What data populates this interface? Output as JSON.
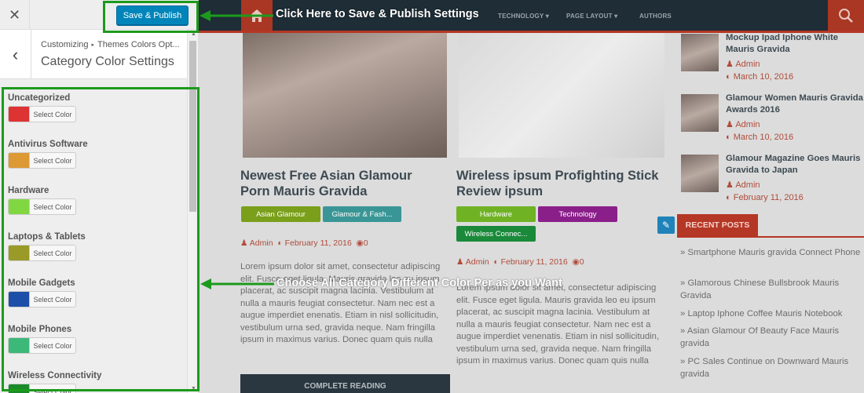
{
  "customizer": {
    "close_symbol": "✕",
    "save_label": "Save & Publish",
    "back_symbol": "‹",
    "breadcrumb_root": "Customizing",
    "breadcrumb_separator": "▸",
    "breadcrumb_parent": "Themes Colors Opt...",
    "section_title": "Category Color Settings",
    "scroll_up": "▲",
    "scroll_down": "▼",
    "picker_label": "Select Color",
    "categories": [
      {
        "label": "Uncategorized",
        "color": "#dd3333"
      },
      {
        "label": "Antivirus Software",
        "color": "#dd9933"
      },
      {
        "label": "Hardware",
        "color": "#81d742"
      },
      {
        "label": "Laptops & Tablets",
        "color": "#999a28"
      },
      {
        "label": "Mobile Gadgets",
        "color": "#1e4fa8"
      },
      {
        "label": "Mobile Phones",
        "color": "#3cb878"
      },
      {
        "label": "Wireless Connectivity",
        "color": "#1a8a2a"
      }
    ]
  },
  "preview": {
    "nav": {
      "technology": "TECHNOLOGY",
      "page_layout": "PAGE LAYOUT",
      "authors": "AUTHORS",
      "chevron": "▾"
    },
    "posts": [
      {
        "title": "Newest Free Asian Glamour Porn Mauris Gravida",
        "tags": [
          {
            "label": "Asian Glamour",
            "color": "#7a9f1a"
          },
          {
            "label": "Glamour & Fash...",
            "color": "#3a9696"
          }
        ],
        "author": "Admin",
        "date": "February 11, 2016",
        "comments": "0",
        "excerpt": "Lorem ipsum dolor sit amet, consectetur adipiscing elit. Fusce eget ligula. Mauris gravida leo eu ipsum placerat, ac suscipit magna lacinia. Vestibulum at nulla a mauris feugiat consectetur. Nam nec est a augue imperdiet enenatis. Etiam in nisl sollicitudin, vestibulum urna sed, gravida neque. Nam fringilla ipsum in maximus varius. Donec  quam quis nulla",
        "read_more": "COMPLETE READING"
      },
      {
        "title": "Wireless ipsum Profighting Stick Review ipsum",
        "tags": [
          {
            "label": "Hardware",
            "color": "#6fb325"
          },
          {
            "label": "Technology",
            "color": "#8a1f8a"
          },
          {
            "label": "Wireless Connec...",
            "color": "#1a8a3a"
          }
        ],
        "author": "Admin",
        "date": "February 11, 2016",
        "comments": "0",
        "excerpt": "Lorem ipsum dolor sit amet, consectetur adipiscing elit. Fusce eget ligula. Mauris gravida leo eu ipsum placerat, ac suscipit magna lacinia. Vestibulum at nulla a mauris feugiat consectetur. Nam nec est a augue imperdiet venenatis. Etiam in nisl sollicitudin, vestibulum urna sed, gravida neque. Nam fringilla ipsum in maximus varius. Donec quam quis nulla"
      }
    ],
    "sidebar_posts": [
      {
        "title": "Mockup Ipad Iphone White Mauris Gravida",
        "author": "Admin",
        "date": "March 10, 2016"
      },
      {
        "title": "Glamour Women Mauris Gravida Awards 2016",
        "author": "Admin",
        "date": "March 10, 2016"
      },
      {
        "title": "Glamour Magazine Goes Mauris Gravida to Japan",
        "author": "Admin",
        "date": "February 11, 2016"
      }
    ],
    "recent_heading": "RECENT POSTS",
    "recent_posts": [
      "Smartphone Mauris gravida Connect Phone",
      "Glamorous Chinese Bullsbrook Mauris Gravida",
      "Laptop Iphone Coffee Mauris Notebook",
      "Asian Glamour Of Beauty Face Mauris gravida",
      "PC Sales Continue on Downward Mauris gravida"
    ],
    "recent_bullet": "»"
  },
  "annotations": {
    "save_hint": "Click Here to Save & Publish Settings",
    "color_hint": "Choose All Category Different Color Per as you Want",
    "color": "#1c9a1c"
  }
}
